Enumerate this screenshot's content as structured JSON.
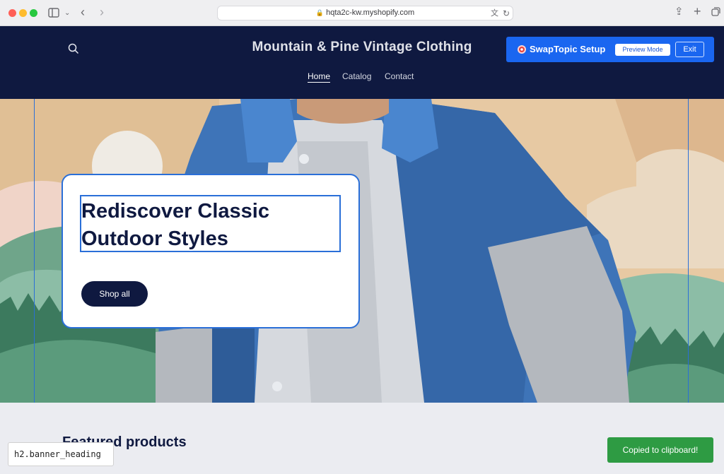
{
  "browser": {
    "url": "hqta2c-kw.myshopify.com",
    "traffic_lights": {
      "close": "#ff5f57",
      "minimize": "#febc2e",
      "zoom": "#28c840"
    },
    "icons": [
      "sidebar-icon",
      "chevron-down-icon",
      "back-icon",
      "forward-icon",
      "lock-icon",
      "translate-icon",
      "reload-icon",
      "share-icon",
      "new-tab-icon",
      "tabs-icon"
    ]
  },
  "store": {
    "title": "Mountain & Pine Vintage Clothing",
    "nav": [
      {
        "label": "Home",
        "active": true
      },
      {
        "label": "Catalog",
        "active": false
      },
      {
        "label": "Contact",
        "active": false
      }
    ],
    "search_icon": "search-icon",
    "brand_color": "#0f1940"
  },
  "swaptopic": {
    "label": "SwapTopic Setup",
    "icon": "target-icon",
    "preview_button": "Preview Mode",
    "exit_button": "Exit",
    "accent": "#1a66f0"
  },
  "banner": {
    "heading": "Rediscover Classic Outdoor Styles",
    "button": "Shop all",
    "selection_color": "#2a6fd8"
  },
  "featured": {
    "title": "Featured products"
  },
  "inspector_tag": "h2.banner_heading",
  "toast": {
    "message": "Copied to clipboard!",
    "color": "#2e9b43"
  }
}
